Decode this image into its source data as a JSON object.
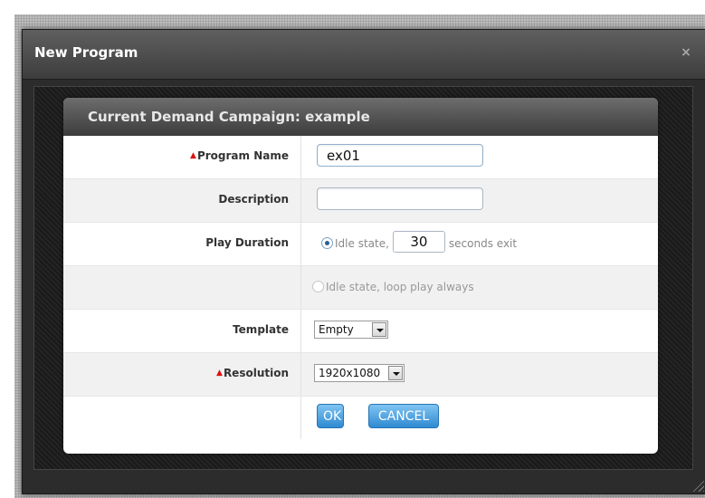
{
  "window": {
    "title": "New Program",
    "close_glyph": "×"
  },
  "panel": {
    "header": "Current Demand Campaign: example"
  },
  "form": {
    "program_name": {
      "label": "Program Name",
      "required": true,
      "value": "ex01"
    },
    "description": {
      "label": "Description",
      "value": ""
    },
    "play_duration": {
      "label": "Play Duration",
      "option1_text": "Idle state,",
      "seconds_value": "30",
      "seconds_suffix": "seconds exit",
      "option2_text": "Idle state, loop play always",
      "selected": "option1"
    },
    "template": {
      "label": "Template",
      "selected": "Empty"
    },
    "resolution": {
      "label": "Resolution",
      "required": true,
      "selected": "1920x1080"
    }
  },
  "buttons": {
    "ok": "OK",
    "cancel": "CANCEL"
  },
  "colors": {
    "required_marker": "#dd1111",
    "button_blue": "#2f8ad1"
  }
}
